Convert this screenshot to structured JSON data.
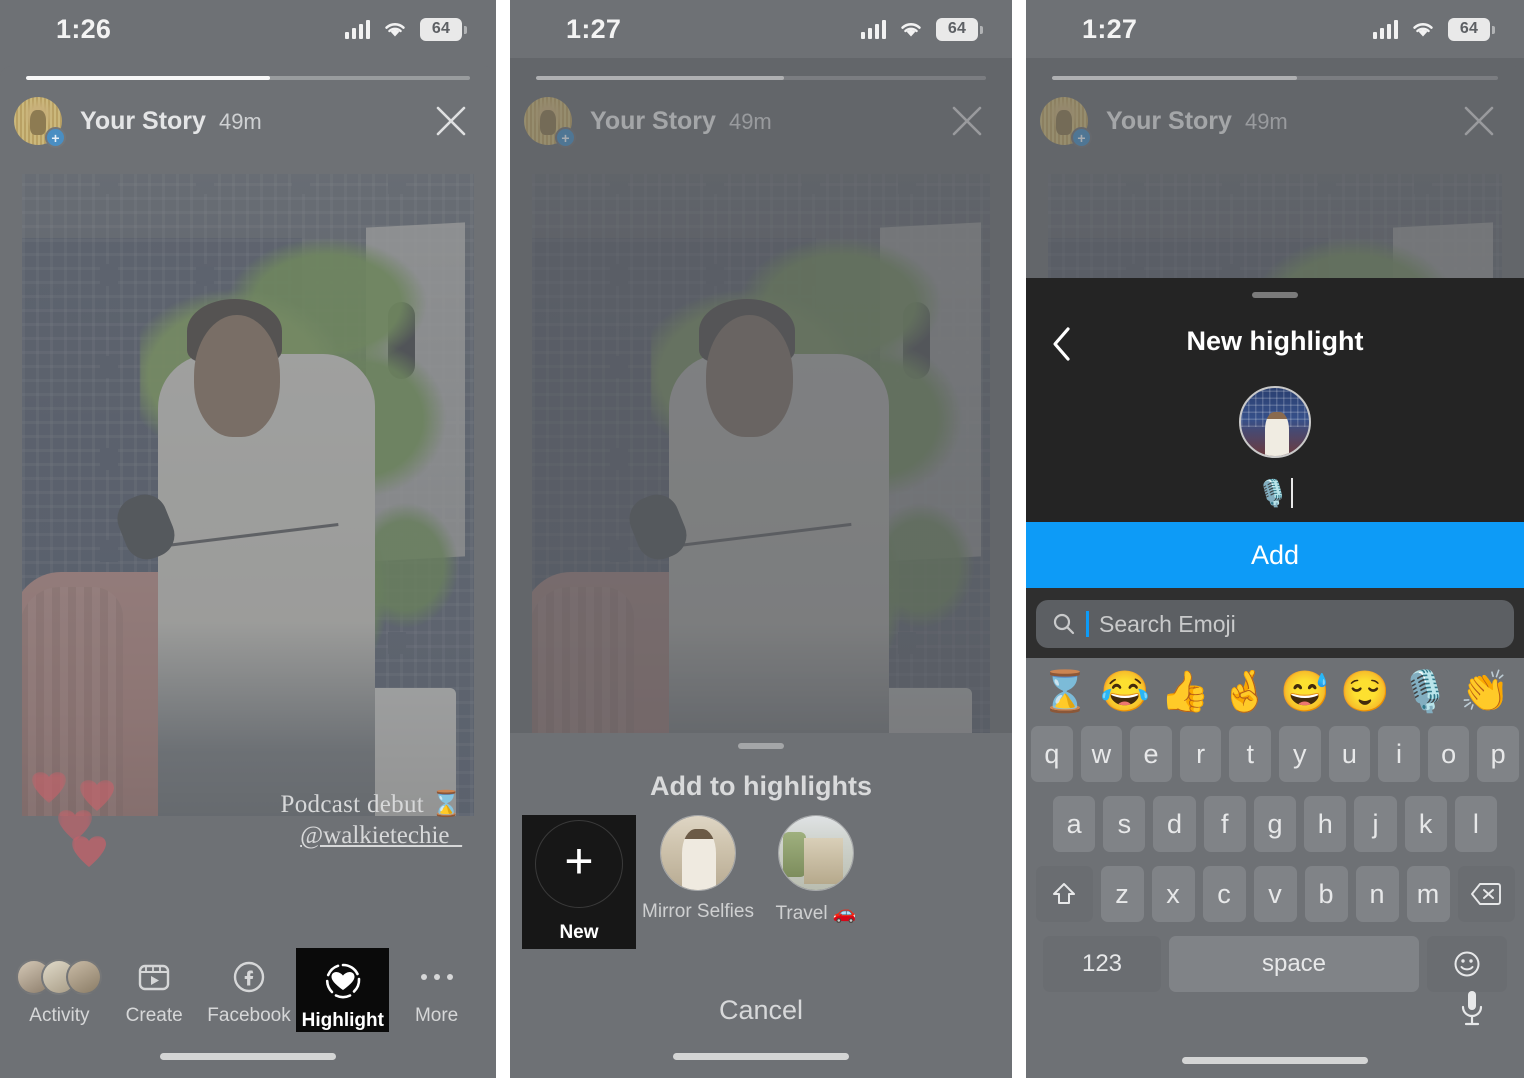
{
  "panels": [
    {
      "id": "story-viewer",
      "status": {
        "time": "1:26",
        "battery": "64",
        "wifi_icon": "wifi-icon",
        "cellular_icon": "cellular-bars-icon"
      },
      "story": {
        "progress_percent": 55,
        "username": "Your Story",
        "timestamp": "49m",
        "close_icon": "close-icon",
        "avatar_badge": "+",
        "caption_line1": "Podcast debut ⌛",
        "caption_line2": "@walkietechie_"
      },
      "actions": [
        {
          "label": "Activity",
          "icon": "activity-avatars-icon",
          "active": false
        },
        {
          "label": "Create",
          "icon": "create-icon",
          "active": false
        },
        {
          "label": "Facebook",
          "icon": "facebook-icon",
          "active": false
        },
        {
          "label": "Highlight",
          "icon": "highlight-heart-icon",
          "active": true
        },
        {
          "label": "More",
          "icon": "more-dots-icon",
          "active": false
        }
      ]
    },
    {
      "id": "add-to-highlights-sheet",
      "status": {
        "time": "1:27",
        "battery": "64"
      },
      "story": {
        "username": "Your Story",
        "timestamp": "49m"
      },
      "sheet": {
        "title": "Add to highlights",
        "cancel_label": "Cancel",
        "items": [
          {
            "label": "New",
            "icon": "plus-icon",
            "type": "new"
          },
          {
            "label": "Mirror Selfies",
            "icon": "highlight-cover-icon",
            "type": "highlight"
          },
          {
            "label": "Travel 🚗",
            "icon": "highlight-cover-icon",
            "type": "highlight"
          }
        ]
      }
    },
    {
      "id": "new-highlight-keyboard",
      "status": {
        "time": "1:27",
        "battery": "64"
      },
      "story": {
        "username": "Your Story",
        "timestamp": "49m"
      },
      "modal": {
        "title": "New highlight",
        "back_icon": "chevron-left-icon",
        "cover_icon": "highlight-cover-avatar",
        "name_value": "🎙️",
        "add_label": "Add"
      },
      "keyboard": {
        "search_placeholder": "Search Emoji",
        "search_value": "",
        "search_icon": "search-icon",
        "suggested_emoji": [
          "⌛",
          "😂",
          "👍",
          "🤞",
          "😅",
          "😌",
          "🎙️",
          "👏"
        ],
        "rows": [
          [
            "q",
            "w",
            "e",
            "r",
            "t",
            "y",
            "u",
            "i",
            "o",
            "p"
          ],
          [
            "a",
            "s",
            "d",
            "f",
            "g",
            "h",
            "j",
            "k",
            "l"
          ],
          [
            "z",
            "x",
            "c",
            "v",
            "b",
            "n",
            "m"
          ]
        ],
        "shift_icon": "shift-icon",
        "backspace_icon": "backspace-icon",
        "numbers_label": "123",
        "space_label": "space",
        "emoji_key_icon": "emoji-smiley-icon",
        "dictation_icon": "microphone-icon"
      }
    }
  ],
  "colors": {
    "accent_blue": "#0d9bf7",
    "panel_bg": "#6e7175",
    "modal_bg": "#242424",
    "active_black": "#0a0a0a"
  }
}
